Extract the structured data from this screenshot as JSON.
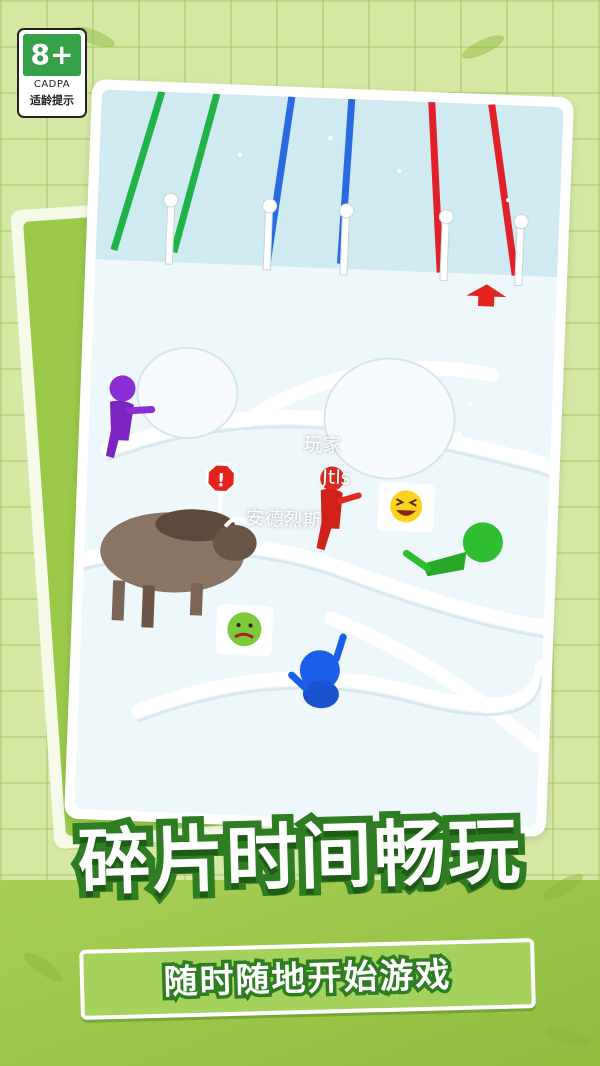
{
  "age_rating": {
    "age": "8+",
    "org": "CADPA",
    "tip": "适龄提示",
    "color": "#35a048"
  },
  "game_scene": {
    "name_tags": [
      "玩家",
      "Jtls",
      "安德烈斯"
    ],
    "emotes": [
      "laughing-emoji",
      "sick-emoji"
    ],
    "warning_sign": "!",
    "characters": [
      "purple-runner",
      "red-runner",
      "green-runner",
      "blue-runner",
      "bison"
    ],
    "colors": {
      "purple": "#8b2ed6",
      "red": "#e3281c",
      "green": "#2fbe2f",
      "blue": "#1b5ee8",
      "snow": "#eef7fa",
      "bison": "#8a7463"
    }
  },
  "headline": "碎片时间畅玩",
  "subtitle": "随时随地开始游戏",
  "theme": {
    "background": "#d5e8a4",
    "headline_stroke": "#2e7d22",
    "banner": "#a5d25c"
  }
}
